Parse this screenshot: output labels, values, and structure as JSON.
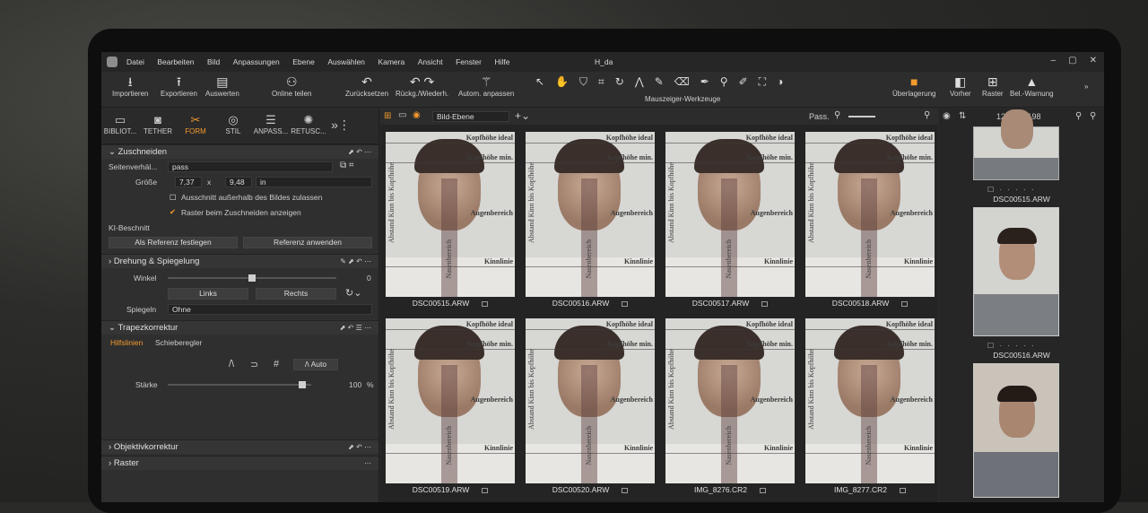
{
  "menu": [
    "Datei",
    "Bearbeiten",
    "Bild",
    "Anpassungen",
    "Ebene",
    "Auswählen",
    "Kamera",
    "Ansicht",
    "Fenster",
    "Hilfe"
  ],
  "window_title": "H_da",
  "toolbar": {
    "import": "Importieren",
    "export": "Exportieren",
    "evaluate": "Auswerten",
    "share": "Online teilen",
    "reset": "Zurücksetzen",
    "undo": "Rückg./Wiederh.",
    "auto": "Autom. anpassen",
    "cursor_tools": "Mauszeiger-Werkzeuge",
    "overlay": "Überlagerung",
    "before": "Vorher",
    "grid": "Raster",
    "exposure": "Bel.-Warnung"
  },
  "left_tabs": [
    "BIBLIOT...",
    "TETHER",
    "FORM",
    "STIL",
    "ANPASS...",
    "RETUSC..."
  ],
  "crop": {
    "title": "Zuschneiden",
    "aspect_label": "Seitenverhäl...",
    "aspect_value": "pass",
    "size_label": "Größe",
    "width": "7,37",
    "x": "x",
    "height": "9,48",
    "unit": "in",
    "allow_outside": "Ausschnitt außerhalb des Bildes zulassen",
    "show_grid": "Raster beim Zuschneiden anzeigen",
    "ai_label": "KI-Beschnitt",
    "set_ref": "Als Referenz festlegen",
    "apply_ref": "Referenz anwenden"
  },
  "rotate": {
    "title": "Drehung & Spiegelung",
    "angle_label": "Winkel",
    "angle_value": "0",
    "left": "Links",
    "right": "Rechts",
    "mirror_label": "Spiegeln",
    "mirror_value": "Ohne"
  },
  "keystone": {
    "title": "Trapezkorrektur",
    "tab1": "Hilfslinien",
    "tab2": "Schieberegler",
    "auto": "Auto",
    "strength_label": "Stärke",
    "strength_value": "100",
    "unit": "%"
  },
  "lens": {
    "title": "Objektivkorrektur"
  },
  "grid_sec": {
    "title": "Raster"
  },
  "center": {
    "layer": "Bild-Ebene",
    "filter": "Pass."
  },
  "overlay_text": {
    "head_ideal": "Kopfhöhe ideal",
    "head_min": "Kopfhöhe min.",
    "eyes": "Augenbereich",
    "chin": "Kinnlinie",
    "nose": "Nasenbereich",
    "chin_dist": "Abstand Kinn bis Kopfhöhe"
  },
  "thumbs": [
    "DSC00515.ARW",
    "DSC00516.ARW",
    "DSC00517.ARW",
    "DSC00518.ARW",
    "DSC00519.ARW",
    "DSC00520.ARW",
    "IMG_8276.CR2",
    "IMG_8277.CR2"
  ],
  "right": {
    "count": "12 von 8198",
    "items": [
      "DSC00515.ARW",
      "DSC00516.ARW"
    ]
  }
}
